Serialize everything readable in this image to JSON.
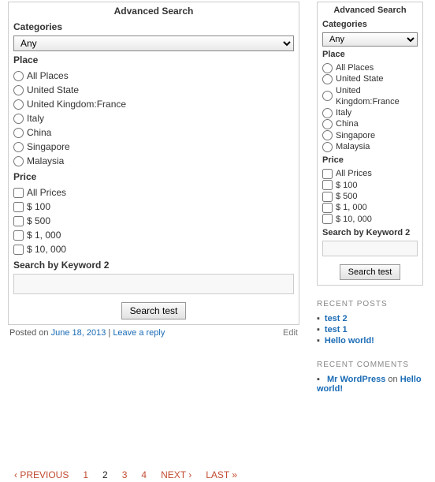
{
  "searchbox": {
    "title": "Advanced Search",
    "categories_label": "Categories",
    "category_selected": "Any",
    "place_label": "Place",
    "place_options": [
      "All Places",
      "United State",
      "United Kingdom:France",
      "Italy",
      "China",
      "Singapore",
      "Malaysia"
    ],
    "price_label": "Price",
    "price_options": [
      "All Prices",
      "$ 100",
      "$ 500",
      "$ 1, 000",
      "$ 10, 000"
    ],
    "keyword_label": "Search by Keyword 2",
    "button_label": "Search test"
  },
  "meta": {
    "posted_prefix": "Posted on ",
    "posted_date": "June 18, 2013",
    "separator": " | ",
    "reply_text": "Leave a reply",
    "edit_text": "Edit"
  },
  "sidebar": {
    "recent_posts_heading": "RECENT POSTS",
    "recent_posts": [
      "test 2",
      "test 1",
      "Hello world!"
    ],
    "recent_comments_heading": "RECENT COMMENTS",
    "commenter": "Mr WordPress",
    "comment_on": " on ",
    "comment_target": "Hello world!"
  },
  "pagination": {
    "prev": "‹ PREVIOUS",
    "pages": [
      "1",
      "2",
      "3",
      "4"
    ],
    "current": "2",
    "next": "NEXT ›",
    "last": "LAST »"
  }
}
